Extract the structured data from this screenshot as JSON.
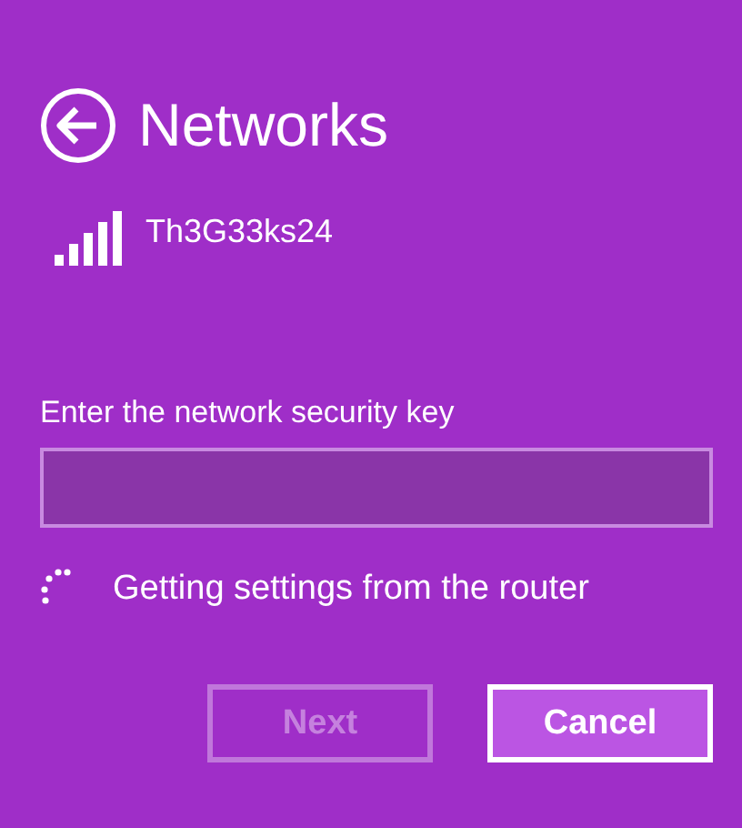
{
  "header": {
    "title": "Networks"
  },
  "network": {
    "name": "Th3G33ks24"
  },
  "security_key": {
    "label": "Enter the network security key"
  },
  "status": {
    "text": "Getting settings from the router"
  },
  "buttons": [
    {
      "label": "Next",
      "disabled": true,
      "focused": false
    },
    {
      "label": "Cancel",
      "disabled": false,
      "focused": true
    }
  ]
}
